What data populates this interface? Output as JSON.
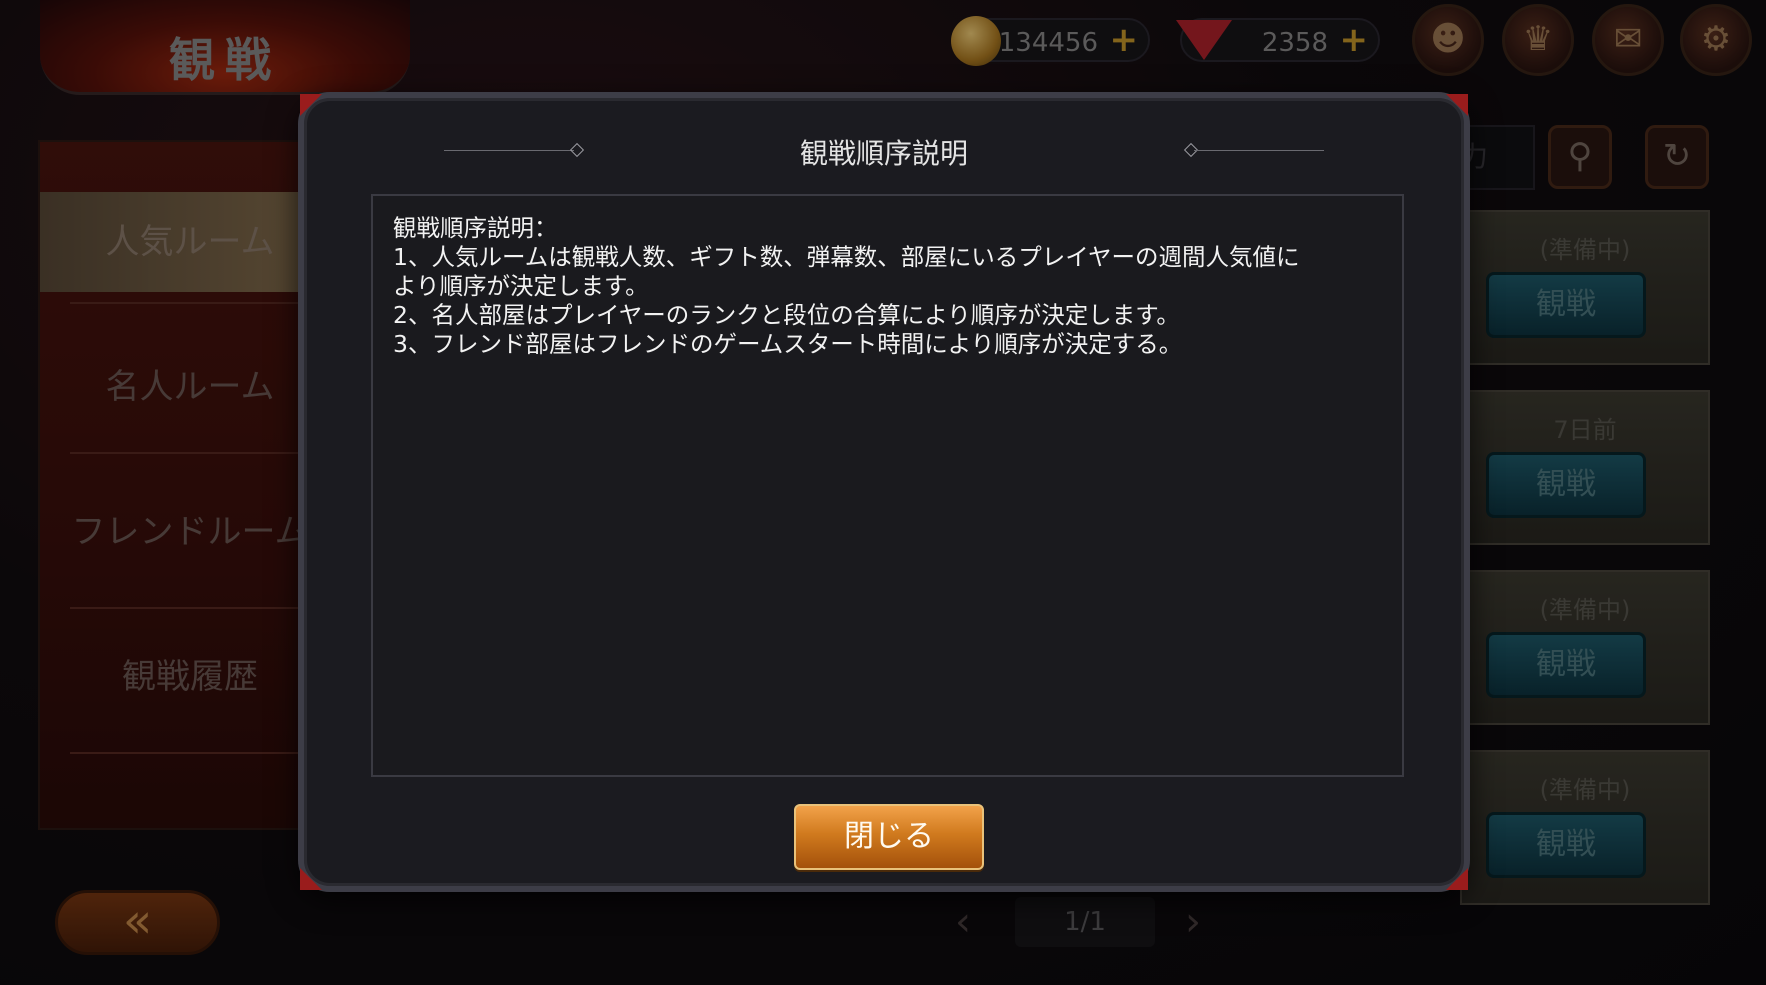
{
  "header": {
    "title": "観戦",
    "coins": "134456",
    "gems": "2358"
  },
  "icons": {
    "profile": "person-icon",
    "ranking": "trophy-icon",
    "mail": "mail-icon",
    "settings": "gear-icon",
    "search": "search-icon",
    "refresh": "refresh-icon",
    "back": "back-arrow-icon"
  },
  "sidebar": {
    "items": [
      {
        "label": "人気ルーム"
      },
      {
        "label": "名人ルーム"
      },
      {
        "label": "フレンドルーム"
      },
      {
        "label": "観戦履歴"
      }
    ]
  },
  "search": {
    "placeholder_fragment": "力"
  },
  "rooms": [
    {
      "status": "(準備中)",
      "button": "観戦"
    },
    {
      "status": "7日前",
      "button": "観戦"
    },
    {
      "status": "(準備中)",
      "button": "観戦"
    },
    {
      "status": "(準備中)",
      "button": "観戦"
    }
  ],
  "pager": {
    "text": "1/1"
  },
  "modal": {
    "title": "観戦順序説明",
    "lines": [
      "観戦順序説明：",
      "1、人気ルームは観戦人数、ギフト数、弾幕数、部屋にいるプレイヤーの週間人気値に",
      "より順序が決定します。",
      "2、名人部屋はプレイヤーのランクと段位の合算により順序が決定します。",
      "3、フレンド部屋はフレンドのゲームスタート時間により順序が決定する。"
    ],
    "close_label": "閉じる"
  },
  "colors": {
    "accent_orange": "#d07a1e",
    "modal_bg": "#1b1b20",
    "corner_red": "#9a1c1c",
    "watch_teal": "#1e5a6a"
  }
}
